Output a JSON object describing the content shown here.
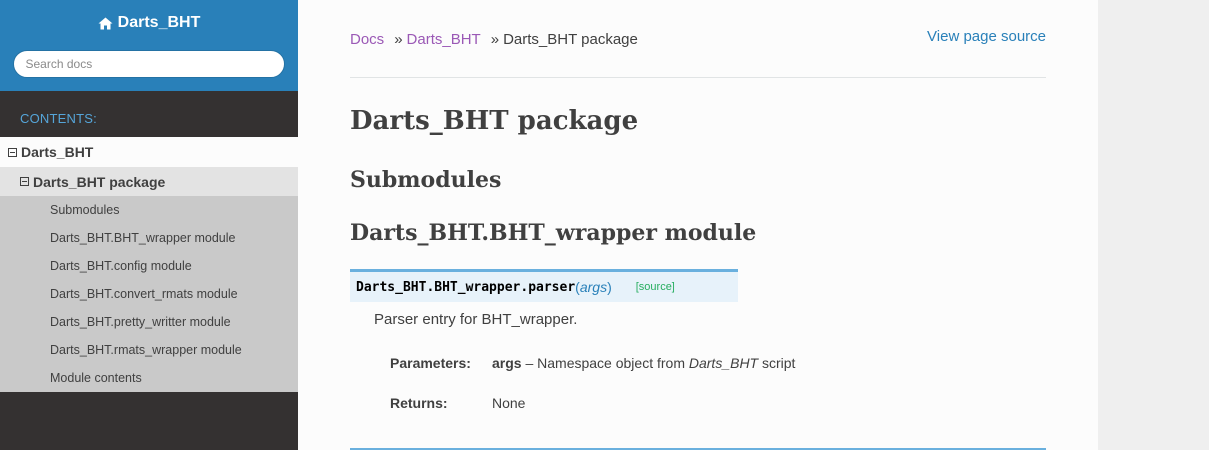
{
  "sidebar": {
    "project_title": "Darts_BHT",
    "search_placeholder": "Search docs",
    "caption": "Contents:",
    "toc_level1": "Darts_BHT",
    "toc_level2": "Darts_BHT package",
    "toc_level3": [
      "Submodules",
      "Darts_BHT.BHT_wrapper module",
      "Darts_BHT.config module",
      "Darts_BHT.convert_rmats module",
      "Darts_BHT.pretty_writter module",
      "Darts_BHT.rmats_wrapper module",
      "Module contents"
    ]
  },
  "breadcrumbs": {
    "docs": "Docs",
    "separator": "»",
    "parent": "Darts_BHT",
    "current": "Darts_BHT package",
    "view_source": "View page source"
  },
  "page": {
    "title": "Darts_BHT package",
    "submodules_heading": "Submodules",
    "module_heading": "Darts_BHT.BHT_wrapper module"
  },
  "function": {
    "module_prefix": "Darts_BHT.BHT_wrapper.",
    "name": "parser",
    "open_paren": "(",
    "arg": "args",
    "close_paren": ")",
    "source_label": "[source]",
    "description": "Parser entry for BHT_wrapper.",
    "params_label": "Parameters:",
    "param_name": "args",
    "param_dash": " – Namespace object from ",
    "param_ref": "Darts_BHT",
    "param_suffix": " script",
    "returns_label": "Returns:",
    "returns_value": "None"
  },
  "colors": {
    "sidebar_header": "#2980b9",
    "sidebar_bg": "#343131",
    "link_visited": "#9b59b6",
    "link": "#2980b9",
    "source_link": "#27ae60"
  }
}
